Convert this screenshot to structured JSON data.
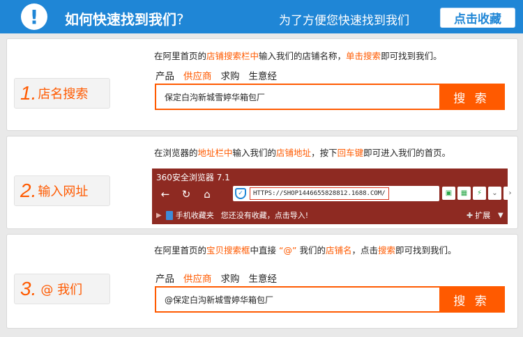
{
  "header": {
    "exclaim": "!",
    "title": "如何快速找到我们",
    "title_suffix": "?",
    "subtitle": "为了方便您快速找到我们",
    "favorite_button": "点击收藏"
  },
  "step1": {
    "num": "1.",
    "label": "店名搜索",
    "instr_a": "在阿里首页的",
    "instr_b": "店铺搜索栏中",
    "instr_c": "输入我们的店铺名称，",
    "instr_d": "单击搜索",
    "instr_e": "即可找到我们。",
    "tabs": [
      "产品",
      "供应商",
      "求购",
      "生意经"
    ],
    "search_value": "保定白沟新城雪婷华箱包厂",
    "search_button": "搜 索"
  },
  "step2": {
    "num": "2.",
    "label": "输入网址",
    "instr_a": "在浏览器的",
    "instr_b": "地址栏中",
    "instr_c": "输入我们的",
    "instr_d": "店铺地址",
    "instr_e": "，按下",
    "instr_f": "回车键",
    "instr_g": "即可进入我们的首页。",
    "browser": {
      "title": "360安全浏览器 7.1",
      "url": "HTTPS://SHOP1446655828812.1688.COM/",
      "favorites_label": "手机收藏夹",
      "favorites_hint": "您还没有收藏，点击导入!",
      "expand_label": "扩展"
    }
  },
  "step3": {
    "num": "3.",
    "label": "@ 我们",
    "instr_a": "在阿里首页的",
    "instr_b": "宝贝搜索框",
    "instr_c": "中直接 ",
    "instr_d": "“@”",
    "instr_e": " 我们的",
    "instr_f": "店铺名",
    "instr_g": "，点击",
    "instr_h": "搜索",
    "instr_i": "即可找到我们。",
    "tabs": [
      "产品",
      "供应商",
      "求购",
      "生意经"
    ],
    "search_value": "@保定白沟新城雪婷华箱包厂",
    "search_button": "搜 索"
  },
  "colors": {
    "header_blue": "#1f86d6",
    "accent_orange": "#ff5a00",
    "browser_red": "#8e2a22"
  },
  "icons": {
    "exclaim": "exclamation-icon",
    "back": "back-arrow-icon",
    "reload": "reload-icon",
    "home": "home-icon",
    "shield": "shield-icon"
  }
}
